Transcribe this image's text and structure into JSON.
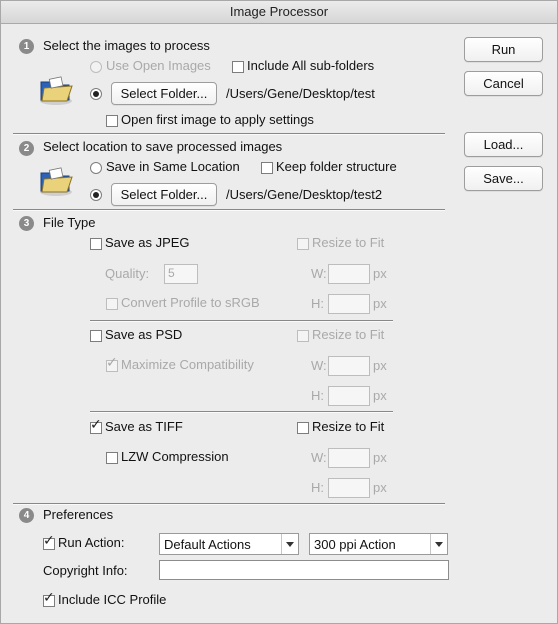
{
  "window": {
    "title": "Image Processor"
  },
  "buttons": {
    "run": "Run",
    "cancel": "Cancel",
    "load": "Load...",
    "save": "Save..."
  },
  "section1": {
    "number": "1",
    "title": "Select the images to process",
    "use_open_images": "Use Open Images",
    "include_subfolders": "Include All sub-folders",
    "select_folder": "Select Folder...",
    "folder_path": "/Users/Gene/Desktop/test",
    "open_first_image": "Open first image to apply settings"
  },
  "section2": {
    "number": "2",
    "title": "Select location to save processed images",
    "save_same_location": "Save in Same Location",
    "keep_folder_structure": "Keep folder structure",
    "select_folder": "Select Folder...",
    "folder_path": "/Users/Gene/Desktop/test2"
  },
  "section3": {
    "number": "3",
    "title": "File Type",
    "jpeg": {
      "save_as": "Save as JPEG",
      "resize_to_fit": "Resize to Fit",
      "quality_label": "Quality:",
      "quality_value": "5",
      "convert_profile": "Convert Profile to sRGB",
      "w_label": "W:",
      "h_label": "H:",
      "unit": "px"
    },
    "psd": {
      "save_as": "Save as PSD",
      "resize_to_fit": "Resize to Fit",
      "maximize_compat": "Maximize Compatibility",
      "w_label": "W:",
      "h_label": "H:",
      "unit": "px"
    },
    "tiff": {
      "save_as": "Save as TIFF",
      "resize_to_fit": "Resize to Fit",
      "lzw": "LZW Compression",
      "w_label": "W:",
      "h_label": "H:",
      "unit": "px"
    }
  },
  "section4": {
    "number": "4",
    "title": "Preferences",
    "run_action": "Run Action:",
    "action_set": "Default Actions",
    "action": "300 ppi Action",
    "copyright_label": "Copyright Info:",
    "copyright_value": "",
    "include_icc": "Include ICC Profile"
  },
  "checkmark": "✓"
}
